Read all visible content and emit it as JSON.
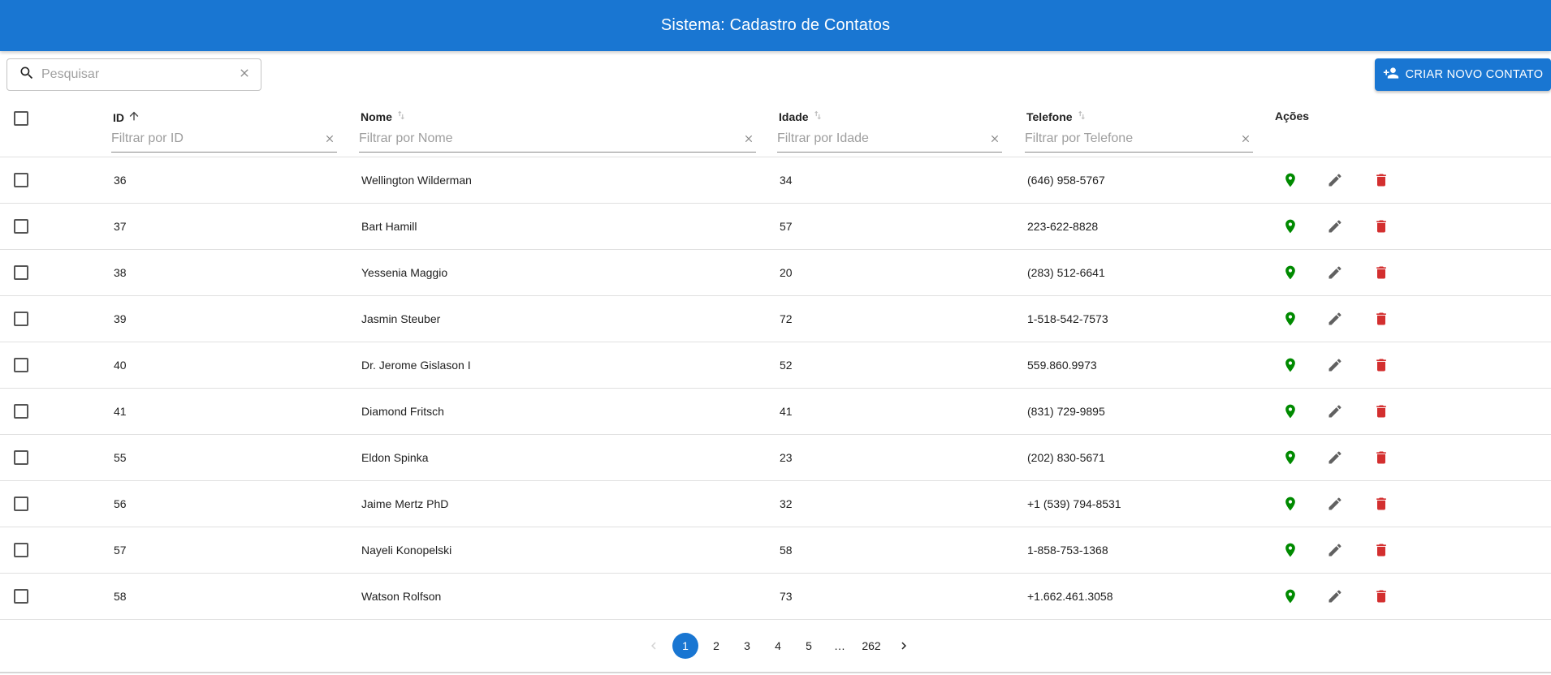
{
  "app": {
    "title": "Sistema: Cadastro de Contatos"
  },
  "colors": {
    "primary": "#1976d2",
    "location": "#008a00",
    "edit": "#616161",
    "delete": "#d32f2f"
  },
  "toolbar": {
    "search_placeholder": "Pesquisar",
    "search_value": "",
    "create_label": "CRIAR NOVO CONTATO",
    "create_icon": "person-add-icon"
  },
  "table": {
    "columns": {
      "id": {
        "label": "ID",
        "filter_placeholder": "Filtrar por ID",
        "sort": "asc"
      },
      "nome": {
        "label": "Nome",
        "filter_placeholder": "Filtrar por Nome",
        "sort": "none"
      },
      "idade": {
        "label": "Idade",
        "filter_placeholder": "Filtrar por Idade",
        "sort": "none"
      },
      "telefone": {
        "label": "Telefone",
        "filter_placeholder": "Filtrar por Telefone",
        "sort": "none"
      },
      "acoes": {
        "label": "Ações"
      }
    },
    "actions": [
      "location-pin-icon",
      "edit-pencil-icon",
      "delete-trash-icon"
    ],
    "rows": [
      {
        "id": "36",
        "nome": "Wellington Wilderman",
        "idade": "34",
        "telefone": "(646) 958-5767"
      },
      {
        "id": "37",
        "nome": "Bart Hamill",
        "idade": "57",
        "telefone": "223-622-8828"
      },
      {
        "id": "38",
        "nome": "Yessenia Maggio",
        "idade": "20",
        "telefone": "(283) 512-6641"
      },
      {
        "id": "39",
        "nome": "Jasmin Steuber",
        "idade": "72",
        "telefone": "1-518-542-7573"
      },
      {
        "id": "40",
        "nome": "Dr. Jerome Gislason I",
        "idade": "52",
        "telefone": "559.860.9973"
      },
      {
        "id": "41",
        "nome": "Diamond Fritsch",
        "idade": "41",
        "telefone": "(831) 729-9895"
      },
      {
        "id": "55",
        "nome": "Eldon Spinka",
        "idade": "23",
        "telefone": "(202) 830-5671"
      },
      {
        "id": "56",
        "nome": "Jaime Mertz PhD",
        "idade": "32",
        "telefone": "+1 (539) 794-8531"
      },
      {
        "id": "57",
        "nome": "Nayeli Konopelski",
        "idade": "58",
        "telefone": "1-858-753-1368"
      },
      {
        "id": "58",
        "nome": "Watson Rolfson",
        "idade": "73",
        "telefone": "+1.662.461.3058"
      }
    ]
  },
  "pagination": {
    "current": "1",
    "pages": [
      "1",
      "2",
      "3",
      "4",
      "5",
      "…",
      "262"
    ]
  }
}
